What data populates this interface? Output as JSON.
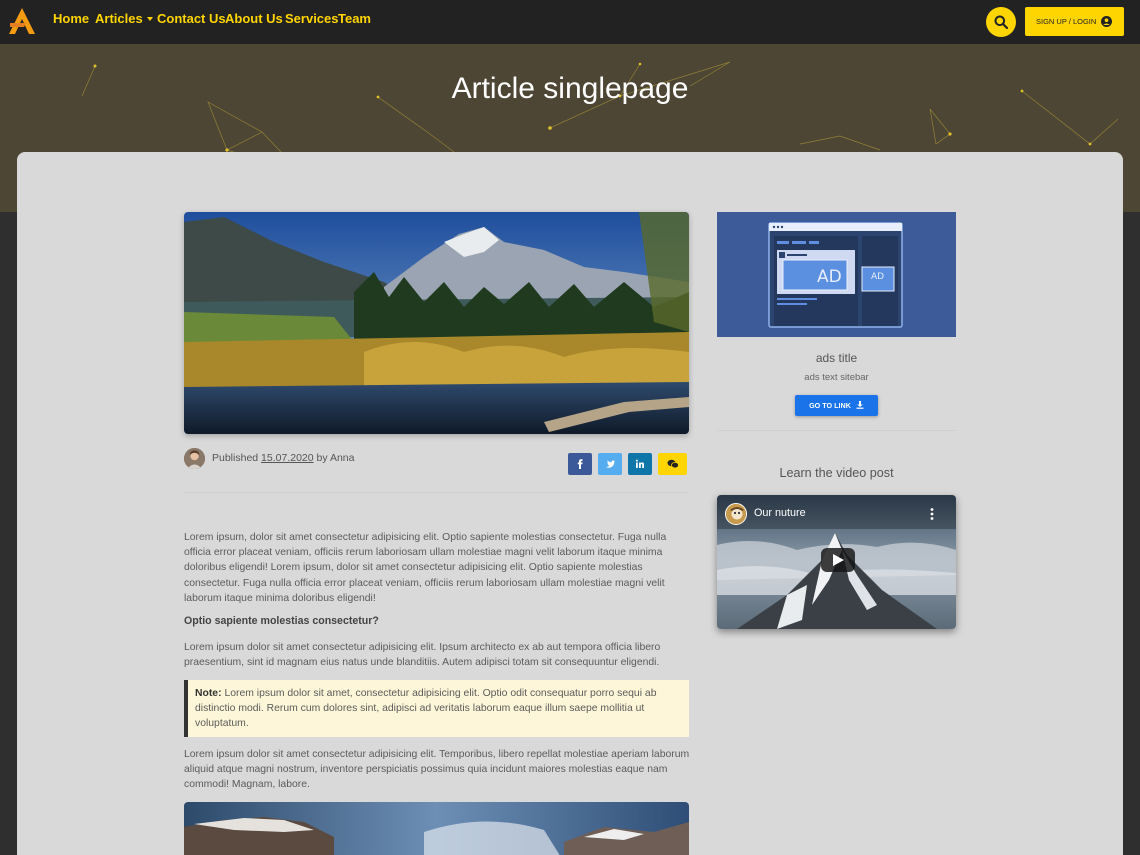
{
  "navbar": {
    "brand": "logo",
    "links": [
      {
        "label": "Home"
      },
      {
        "label": "Articles",
        "has_dropdown": true
      },
      {
        "label": "Contact Us"
      },
      {
        "label": "About Us"
      },
      {
        "label": "Services"
      },
      {
        "label": "Team"
      }
    ],
    "search_icon": "search-icon",
    "signup_label": "SIGN UP / LOGIN",
    "signup_icon": "user-circle-icon",
    "accent_color": "#ffd500"
  },
  "hero": {
    "title": "Article singlepage"
  },
  "article": {
    "meta": {
      "published_label": "Published",
      "date": "15.07.2020",
      "by_label": "by",
      "author": "Anna"
    },
    "share": [
      {
        "icon": "facebook-icon",
        "color": "#3b5998"
      },
      {
        "icon": "twitter-icon",
        "color": "#55acee"
      },
      {
        "icon": "linkedin-icon",
        "color": "#0e76a8"
      },
      {
        "icon": "wechat-icon",
        "color": "#ffd500"
      }
    ],
    "paragraph1": "Lorem ipsum, dolor sit amet consectetur adipisicing elit. Optio sapiente molestias consectetur. Fuga nulla officia error placeat veniam, officiis rerum laboriosam ullam molestiae magni velit laborum itaque minima doloribus eligendi! Lorem ipsum, dolor sit amet consectetur adipisicing elit. Optio sapiente molestias consectetur. Fuga nulla officia error placeat veniam, officiis rerum laboriosam ullam molestiae magni velit laborum itaque minima doloribus eligendi!",
    "subheading": "Optio sapiente molestias consectetur?",
    "paragraph2": "Lorem ipsum dolor sit amet consectetur adipisicing elit. Ipsum architecto ex ab aut tempora officia libero praesentium, sint id magnam eius natus unde blanditiis. Autem adipisci totam sit consequuntur eligendi.",
    "note_label": "Note:",
    "note_text": "Lorem ipsum dolor sit amet, consectetur adipisicing elit. Optio odit consequatur porro sequi ab distinctio modi. Rerum cum dolores sint, adipisci ad veritatis laborum eaque illum saepe mollitia ut voluptatum.",
    "paragraph3": "Lorem ipsum dolor sit amet consectetur adipisicing elit. Temporibus, libero repellat molestiae aperiam laborum aliquid atque magni nostrum, inventore perspiciatis possimus quia incidunt maiores molestias eaque nam commodi! Magnam, labore."
  },
  "sidebar": {
    "ad_image_text": [
      "AD",
      "AD"
    ],
    "ads_title": "ads title",
    "ads_text": "ads text sitebar",
    "goto_label": "GO TO LINK",
    "goto_icon": "download-icon",
    "video_heading": "Learn the video post",
    "video_title": "Our nuture"
  }
}
